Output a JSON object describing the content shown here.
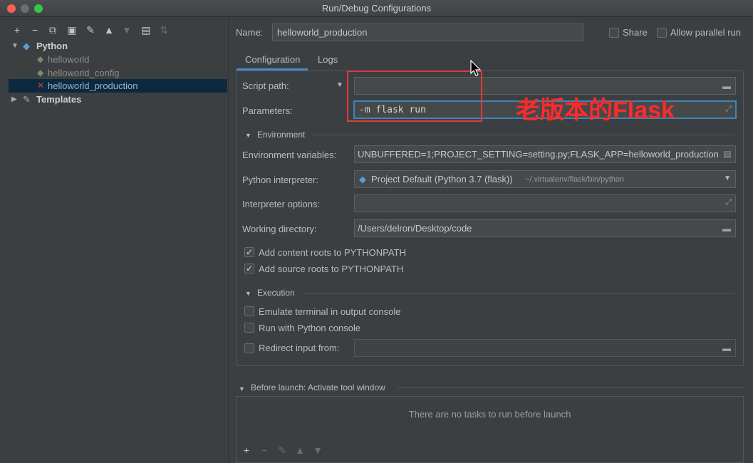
{
  "window": {
    "title": "Run/Debug Configurations"
  },
  "tree": {
    "python_label": "Python",
    "items": [
      "helloworld",
      "helloworld_config",
      "helloworld_production"
    ],
    "templates_label": "Templates"
  },
  "header": {
    "name_label": "Name:",
    "name_value": "helloworld_production",
    "share_label": "Share",
    "parallel_label": "Allow parallel run"
  },
  "tabs": [
    "Configuration",
    "Logs"
  ],
  "config": {
    "script_path_label": "Script path:",
    "script_path_value": "",
    "parameters_label": "Parameters:",
    "parameters_value": "-m flask run",
    "environment_section": "Environment",
    "env_vars_label": "Environment variables:",
    "env_vars_value": "UNBUFFERED=1;PROJECT_SETTING=setting.py;FLASK_APP=helloworld_production",
    "interpreter_label": "Python interpreter:",
    "interpreter_value": "Project Default (Python 3.7 (flask))",
    "interpreter_path": "~/.virtualenv/flask/bin/python",
    "interp_options_label": "Interpreter options:",
    "working_dir_label": "Working directory:",
    "working_dir_value": "/Users/delron/Desktop/code",
    "content_roots_label": "Add content roots to PYTHONPATH",
    "source_roots_label": "Add source roots to PYTHONPATH",
    "execution_section": "Execution",
    "emulate_label": "Emulate terminal in output console",
    "python_console_label": "Run with Python console",
    "redirect_label": "Redirect input from:"
  },
  "before_launch": {
    "header": "Before launch: Activate tool window",
    "empty_text": "There are no tasks to run before launch"
  },
  "annotation": {
    "text": "老版本的Flask",
    "color": "#ff2a2a"
  },
  "colors": {
    "background": "#3c3f41",
    "selection": "#0d293e",
    "accent": "#4a88c7"
  }
}
